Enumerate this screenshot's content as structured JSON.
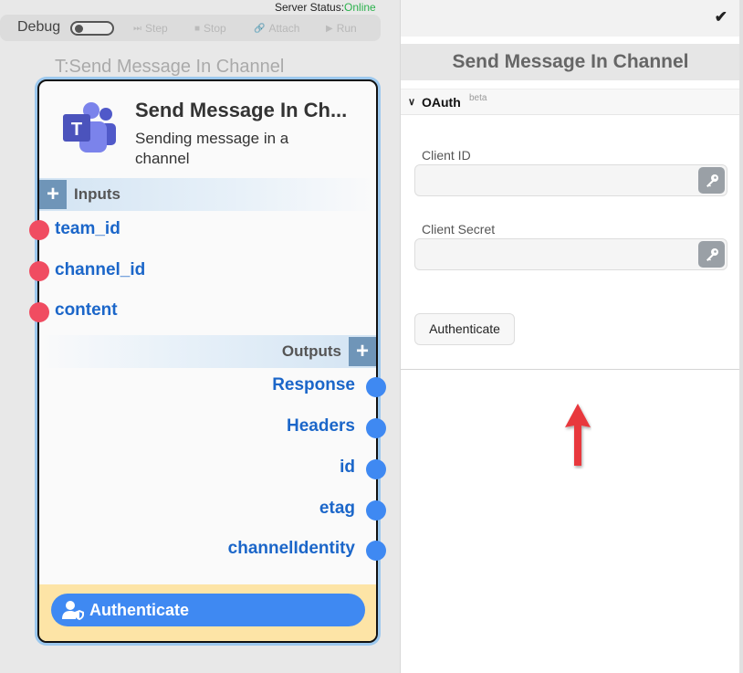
{
  "server_status": {
    "label": "Server Status:",
    "value": "Online"
  },
  "debug": {
    "label": "Debug",
    "buttons": [
      {
        "label": "Step",
        "icon": "step-icon"
      },
      {
        "label": "Stop",
        "icon": "stop-icon"
      },
      {
        "label": "Attach",
        "icon": "link-icon"
      },
      {
        "label": "Run",
        "icon": "play-icon"
      }
    ]
  },
  "node": {
    "canvas_title": "T:Send Message In Channel",
    "name": "Send Message In Ch...",
    "description": "Sending message in a channel",
    "inputs_label": "Inputs",
    "outputs_label": "Outputs",
    "inputs": [
      "team_id",
      "channel_id",
      "content"
    ],
    "outputs": [
      "Response",
      "Headers",
      "id",
      "etag",
      "channelIdentity"
    ],
    "auth_button": "Authenticate"
  },
  "panel": {
    "title": "Send Message In Channel",
    "section": "OAuth",
    "section_badge": "beta",
    "client_id_label": "Client ID",
    "client_id_value": "",
    "client_secret_label": "Client Secret",
    "client_secret_value": "",
    "authenticate_label": "Authenticate"
  },
  "colors": {
    "online": "#2bb24c",
    "port_text": "#1b66c9",
    "input_dot": "#f04c61",
    "output_dot": "#3f89f2",
    "auth_button": "#3f89f2",
    "footer": "#fde4a6",
    "arrow": "#e8383d"
  }
}
